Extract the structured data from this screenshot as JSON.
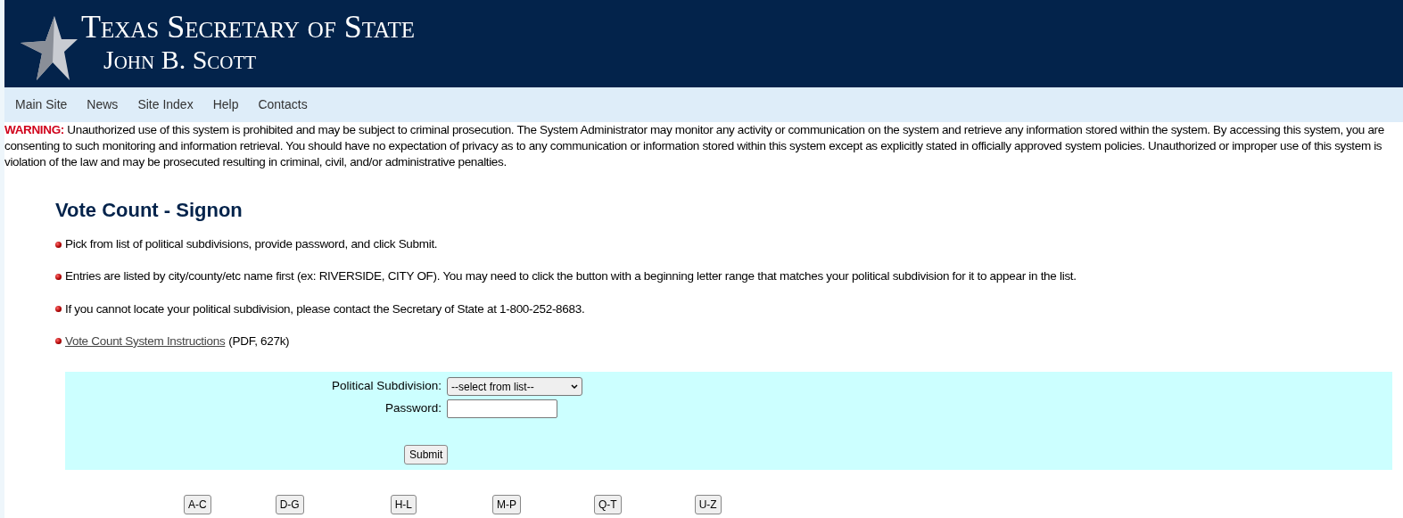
{
  "header": {
    "title": "Texas Secretary of State",
    "subtitle": "John B. Scott"
  },
  "nav": [
    "Main Site",
    "News",
    "Site Index",
    "Help",
    "Contacts"
  ],
  "warning": {
    "label": "WARNING:",
    "text": "Unauthorized use of this system is prohibited and may be subject to criminal prosecution. The System Administrator may monitor any activity or communication on the system and retrieve any information stored within the system. By accessing this system, you are consenting to such monitoring and information retrieval. You should have no expectation of privacy as to any communication or information stored within this system except as explicitly stated in officially approved system policies. Unauthorized or improper use of this system is violation of the law and may be prosecuted resulting in criminal, civil, and/or administrative penalties."
  },
  "heading": "Vote Count - Signon",
  "bullets": [
    {
      "kind": "text",
      "text": "Pick from list of political subdivisions, provide password, and click Submit."
    },
    {
      "kind": "text",
      "text": "Entries are listed by city/county/etc name first (ex: RIVERSIDE, CITY OF). You may need to click the button with a beginning letter range that matches your political subdivision for it to appear in the list."
    },
    {
      "kind": "text",
      "text": "If you cannot locate your political subdivision, please contact the Secretary of State at 1-800-252-8683."
    },
    {
      "kind": "link",
      "link": "Vote Count System Instructions",
      "suffix": "(PDF, 627k)"
    }
  ],
  "form": {
    "fields": [
      {
        "kind": "select",
        "label": "Political Subdivision:",
        "value": "--select from list--"
      },
      {
        "kind": "password",
        "label": "Password:"
      }
    ],
    "submit": "Submit"
  },
  "letter_buttons": [
    "A-C",
    "D-G",
    "H-L",
    "M-P",
    "Q-T",
    "U-Z"
  ]
}
